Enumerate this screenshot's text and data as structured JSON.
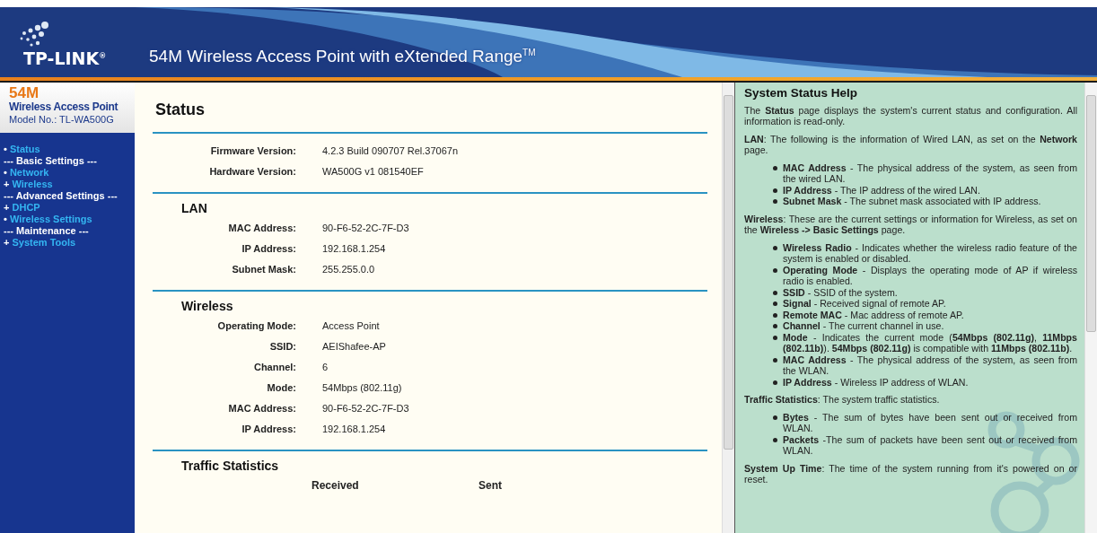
{
  "header": {
    "brand": "TP-LINK$^{®}$",
    "title": "54M Wireless Access Point with eXtended Range$^{TM}$"
  },
  "sidebar": {
    "product": "54M",
    "product_name": "Wireless Access Point",
    "model": "Model No.: TL-WA500G",
    "items": [
      {
        "kind": "link",
        "marker": "•",
        "label": "Status"
      },
      {
        "kind": "group",
        "label": "--- Basic Settings ---"
      },
      {
        "kind": "link",
        "marker": "•",
        "label": "Network"
      },
      {
        "kind": "link",
        "marker": "+",
        "label": "Wireless"
      },
      {
        "kind": "group",
        "label": "--- Advanced Settings ---"
      },
      {
        "kind": "link",
        "marker": "+",
        "label": "DHCP"
      },
      {
        "kind": "link",
        "marker": "•",
        "label": "Wireless Settings"
      },
      {
        "kind": "group",
        "label": "--- Maintenance ---"
      },
      {
        "kind": "link",
        "marker": "+",
        "label": "System Tools"
      }
    ]
  },
  "main": {
    "title": "Status",
    "sections": [
      {
        "rows": [
          {
            "label": "Firmware Version:",
            "value": "4.2.3 Build 090707 Rel.37067n"
          },
          {
            "label": "Hardware Version:",
            "value": "WA500G v1 081540EF"
          }
        ]
      },
      {
        "heading": "LAN",
        "rows": [
          {
            "label": "MAC Address:",
            "value": "90-F6-52-2C-7F-D3"
          },
          {
            "label": "IP Address:",
            "value": "192.168.1.254"
          },
          {
            "label": "Subnet Mask:",
            "value": "255.255.0.0"
          }
        ]
      },
      {
        "heading": "Wireless",
        "rows": [
          {
            "label": "Operating Mode:",
            "value": "Access Point"
          },
          {
            "label": "SSID:",
            "value": "AEIShafee-AP"
          },
          {
            "label": "Channel:",
            "value": "6"
          },
          {
            "label": "Mode:",
            "value": "54Mbps (802.11g)"
          },
          {
            "label": "MAC Address:",
            "value": "90-F6-52-2C-7F-D3"
          },
          {
            "label": "IP Address:",
            "value": "192.168.1.254"
          }
        ]
      },
      {
        "heading": "Traffic Statistics",
        "columns": [
          "Received",
          "Sent"
        ]
      }
    ]
  },
  "help": {
    "title": "System Status Help",
    "blocks": [
      {
        "kind": "paragraph",
        "text": "The **Status** page displays the system's current status and configuration. All information is read-only."
      },
      {
        "kind": "paragraph",
        "text": "**LAN**: The following is the information of Wired LAN, as set on the **Network** page."
      },
      {
        "kind": "list",
        "items": [
          "**MAC Address** - The physical address of the system, as seen from the wired LAN.",
          "**IP Address** - The IP address of the wired LAN.",
          "**Subnet Mask** - The subnet mask associated with IP address."
        ]
      },
      {
        "kind": "paragraph",
        "text": "**Wireless**: These are the current settings or information for Wireless, as set on the **Wireless -> Basic Settings** page."
      },
      {
        "kind": "list",
        "items": [
          "**Wireless Radio** - Indicates whether the wireless radio feature of the system is enabled or disabled.",
          "**Operating Mode** - Displays the operating mode of AP if wireless radio is enabled.",
          "**SSID** - SSID of the system.",
          "**Signal** - Received signal of remote AP.",
          "**Remote MAC** - Mac address of remote AP.",
          "**Channel** - The current channel in use.",
          "**Mode** - Indicates the current mode (**54Mbps (802.11g)**, **11Mbps (802.11b)**). **54Mbps (802.11g)** is compatible with **11Mbps (802.11b)**.",
          "**MAC Address** - The physical address of the system, as seen from the WLAN.",
          "**IP Address** - Wireless IP address of WLAN."
        ]
      },
      {
        "kind": "paragraph",
        "text": "**Traffic Statistics**: The system traffic statistics."
      },
      {
        "kind": "list",
        "items": [
          "**Bytes** - The sum of bytes have been sent out or received from WLAN.",
          "**Packets** -The sum of packets have been sent out or received from WLAN."
        ]
      },
      {
        "kind": "paragraph",
        "text": "**System Up Time**: The time of the system running from it's powered on or reset."
      }
    ]
  }
}
